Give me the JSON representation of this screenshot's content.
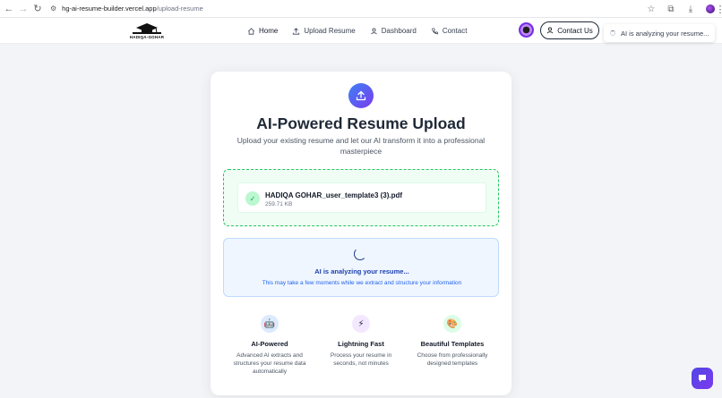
{
  "browser": {
    "url_host": "hg-ai-resume-builder.vercel.app",
    "url_path": "/upload-resume"
  },
  "header": {
    "logo_text": "HADIQA-GOHAR",
    "nav": [
      {
        "label": "Home",
        "icon": "home-icon"
      },
      {
        "label": "Upload Resume",
        "icon": "upload-icon"
      },
      {
        "label": "Dashboard",
        "icon": "user-icon"
      },
      {
        "label": "Contact",
        "icon": "phone-icon"
      }
    ],
    "contact_button": "Contact Us"
  },
  "toast": {
    "text": "AI is analyzing your resume..."
  },
  "card": {
    "title": "AI-Powered Resume Upload",
    "subtitle": "Upload your existing resume and let our AI transform it into a professional masterpiece",
    "file": {
      "name": "HADIQA GOHAR_user_template3 (3).pdf",
      "size": "259.71 KB"
    },
    "analyzing": {
      "title": "AI is analyzing your resume...",
      "subtitle": "This may take a few moments while we extract and structure your information"
    },
    "features": [
      {
        "icon": "robot-icon",
        "glyph": "🤖",
        "color": "#dbeafe",
        "title": "AI-Powered",
        "desc": "Advanced AI extracts and structures your resume data automatically"
      },
      {
        "icon": "lightning-icon",
        "glyph": "⚡",
        "color": "#f3e8ff",
        "title": "Lightning Fast",
        "desc": "Process your resume in seconds, not minutes"
      },
      {
        "icon": "palette-icon",
        "glyph": "🎨",
        "color": "#dcfce7",
        "title": "Beautiful Templates",
        "desc": "Choose from professionally designed templates"
      }
    ]
  }
}
